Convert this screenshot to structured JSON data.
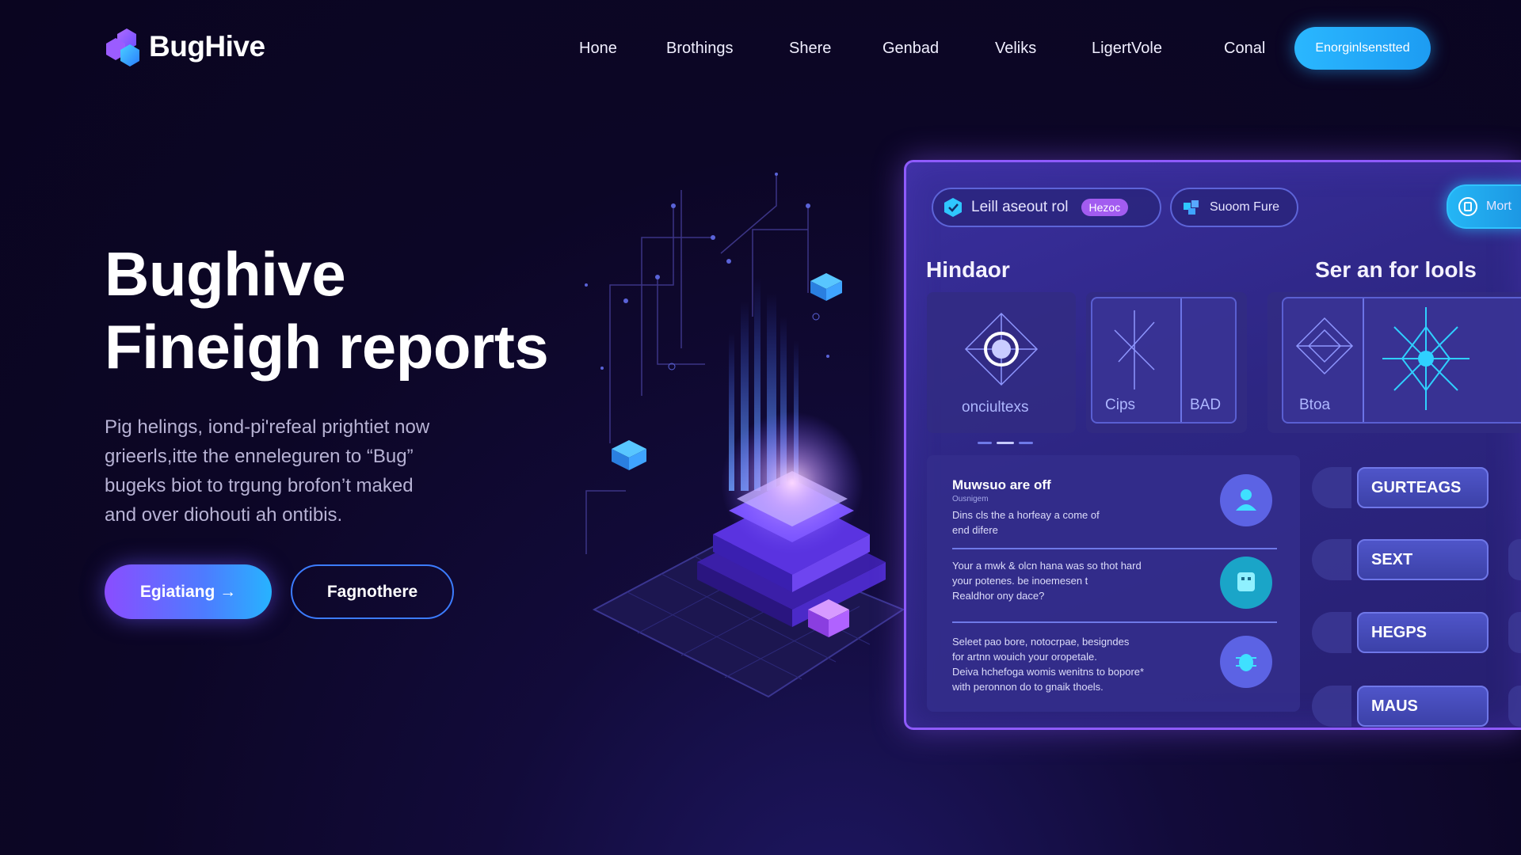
{
  "brand": {
    "name": "BugHive"
  },
  "nav": {
    "items": [
      "Hone",
      "Brothings",
      "Shere",
      "Genbad",
      "Veliks",
      "LigertVole",
      "Conal"
    ],
    "cta_label": "Enorginlsenstted"
  },
  "hero": {
    "title_lines": [
      "Bughive",
      "Fineigh reports"
    ],
    "description_lines": [
      "Pig helings, iond-pi'refeal prightiet now",
      "grieerls,itte the enneleguren to “Bug”",
      "bugeks biot to trgung brofon’t maked",
      "and over diohouti ah ontibis."
    ],
    "primary_button": "Egiatiang →",
    "secondary_button": "Fagnothere"
  },
  "dashboard": {
    "search_pill": {
      "text": "Leill aseout rol",
      "tag": "Hezoc"
    },
    "filter_pill": {
      "text": "Suoom Fure"
    },
    "cyan_pill": {
      "text": "Mort"
    },
    "left_heading": "Hindaor",
    "right_heading": "Ser an for lools",
    "cards": [
      {
        "label": "onciultexs"
      },
      {
        "labels": [
          "Cips",
          "BAD"
        ]
      },
      {
        "labels": [
          "Btoa"
        ]
      }
    ],
    "list": [
      {
        "title": "Muwsuo are off",
        "subtitle": "Ousnigem",
        "lines": [
          "Dins cls the a horfeay a come of",
          "end difere"
        ]
      },
      {
        "title": "",
        "lines": [
          "Your a mwk & olcn hana was so thot hard",
          "your potenes. be inoemesen t",
          "Realdhor ony dace?"
        ]
      },
      {
        "title": "",
        "lines": [
          "Seleet pao bore, notocrpae, besigndes",
          "for artnn wouich your oropetale.",
          "Deiva hchefoga womis wenitns to bopore*",
          "with peronnon do to gnaik thoels."
        ]
      }
    ],
    "side_buttons": [
      "GURTEAGS",
      "SEXT",
      "HEGPS",
      "MAUS"
    ]
  },
  "colors": {
    "accent_cyan": "#27b3ff",
    "accent_violet": "#8a4dff",
    "panel_border": "#8f5bff"
  }
}
